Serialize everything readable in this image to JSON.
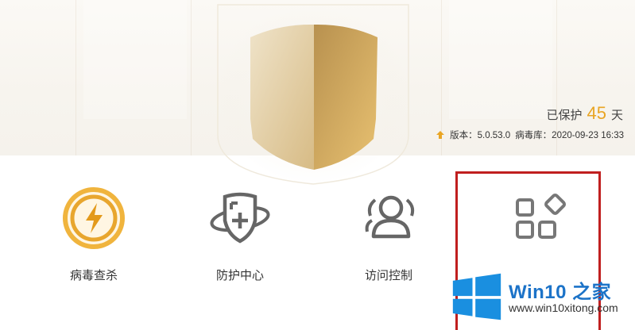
{
  "status": {
    "protect_prefix": "已保护",
    "protect_days": "45",
    "protect_suffix": "天",
    "version_text": "版本：5.0.53.0",
    "virusdb_text": "病毒库：2020-09-23 16:33"
  },
  "features": [
    {
      "label": "病毒查杀",
      "icon": "lightning-circle-icon"
    },
    {
      "label": "防护中心",
      "icon": "shield-plus-icon"
    },
    {
      "label": "访问控制",
      "icon": "users-icon"
    },
    {
      "label": "",
      "icon": "apps-grid-icon"
    }
  ],
  "watermark": {
    "title": "Win10 之家",
    "url": "www.win10xitong.com"
  },
  "colors": {
    "accent": "#e9a524",
    "shield_gold": "#c9a45c",
    "highlight": "#c01f1f",
    "brand_blue": "#1c73c8"
  }
}
